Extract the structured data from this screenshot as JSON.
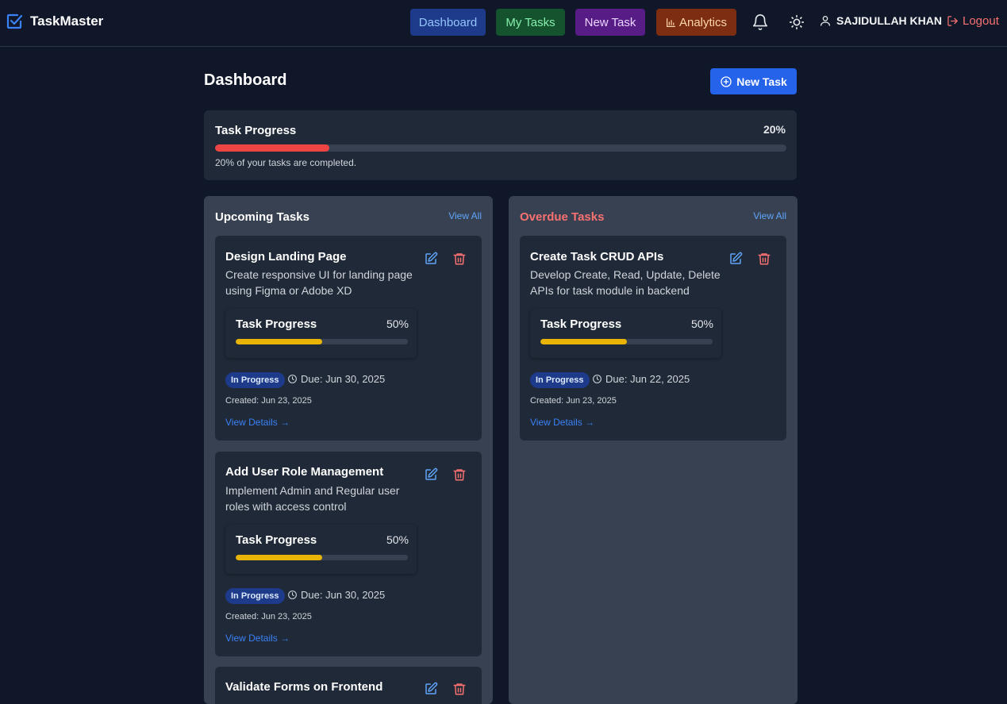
{
  "app": {
    "name": "TaskMaster"
  },
  "nav": {
    "dashboard": "Dashboard",
    "my_tasks": "My Tasks",
    "new_task": "New Task",
    "analytics": "Analytics",
    "user_name": "SAJIDULLAH KHAN",
    "logout": "Logout"
  },
  "page": {
    "title": "Dashboard",
    "new_task_button": "New Task"
  },
  "overall_progress": {
    "title": "Task Progress",
    "percent_label": "20%",
    "percent": 20,
    "subtitle": "20% of your tasks are completed.",
    "bar_color": "#ef4444"
  },
  "upcoming": {
    "title": "Upcoming Tasks",
    "view_all": "View All",
    "tasks": [
      {
        "title": "Design Landing Page",
        "description": "Create responsive UI for landing page using Figma or Adobe XD",
        "progress_title": "Task Progress",
        "progress_label": "50%",
        "progress": 50,
        "status": "In Progress",
        "due": "Due: Jun 30, 2025",
        "created": "Created: Jun 23, 2025",
        "view_details": "View Details →"
      },
      {
        "title": "Add User Role Management",
        "description": "Implement Admin and Regular user roles with access control",
        "progress_title": "Task Progress",
        "progress_label": "50%",
        "progress": 50,
        "status": "In Progress",
        "due": "Due: Jun 30, 2025",
        "created": "Created: Jun 23, 2025",
        "view_details": "View Details →"
      },
      {
        "title": "Validate Forms on Frontend"
      }
    ]
  },
  "overdue": {
    "title": "Overdue Tasks",
    "view_all": "View All",
    "tasks": [
      {
        "title": "Create Task CRUD APIs",
        "description": "Develop Create, Read, Update, Delete APIs for task module in backend",
        "progress_title": "Task Progress",
        "progress_label": "50%",
        "progress": 50,
        "status": "In Progress",
        "due": "Due: Jun 22, 2025",
        "created": "Created: Jun 23, 2025",
        "view_details": "View Details →"
      }
    ]
  },
  "colors": {
    "task_progress_fill": "#eab308",
    "accent": "#2563eb",
    "danger": "#f87171"
  }
}
